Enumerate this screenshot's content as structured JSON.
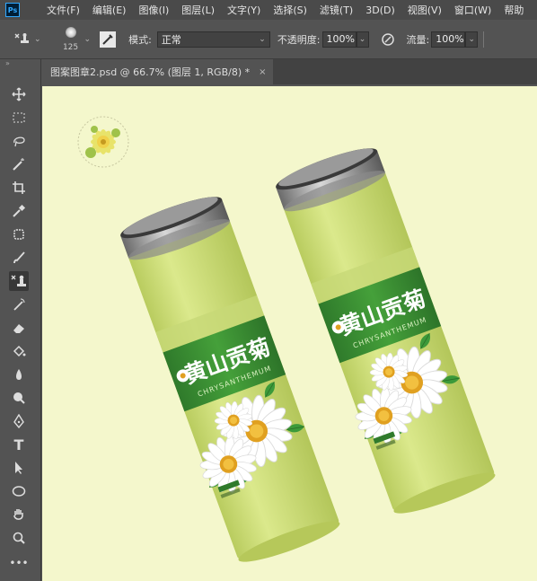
{
  "app": {
    "logo": "Ps"
  },
  "menu": [
    "文件(F)",
    "编辑(E)",
    "图像(I)",
    "图层(L)",
    "文字(Y)",
    "选择(S)",
    "滤镜(T)",
    "3D(D)",
    "视图(V)",
    "窗口(W)",
    "帮助"
  ],
  "options": {
    "brush_size": "125",
    "mode_label": "模式:",
    "mode_value": "正常",
    "opacity_label": "不透明度:",
    "opacity_value": "100%",
    "flow_label": "流量:",
    "flow_value": "100%"
  },
  "document_tab": {
    "title": "图案图章2.psd @ 66.7% (图层 1, RGB/8) *",
    "close": "×"
  },
  "tools": [
    "move-icon",
    "marquee-icon",
    "lasso-icon",
    "magic-wand-icon",
    "crop-icon",
    "eyedropper-icon",
    "healing-brush-icon",
    "brush-icon",
    "pattern-stamp-icon",
    "history-brush-icon",
    "eraser-icon",
    "paint-bucket-icon",
    "blur-icon",
    "dodge-icon",
    "pen-icon",
    "type-icon",
    "path-selection-icon",
    "ellipse-icon",
    "hand-icon",
    "zoom-icon",
    "more-tools-icon"
  ],
  "artwork": {
    "brand_zh": "黄山贡菊",
    "brand_en": "CHRYSANTHEMUM",
    "canvas_color": "#f4f7cc",
    "tin_color": "#cfe07a",
    "band_color": "#3b8a34"
  }
}
